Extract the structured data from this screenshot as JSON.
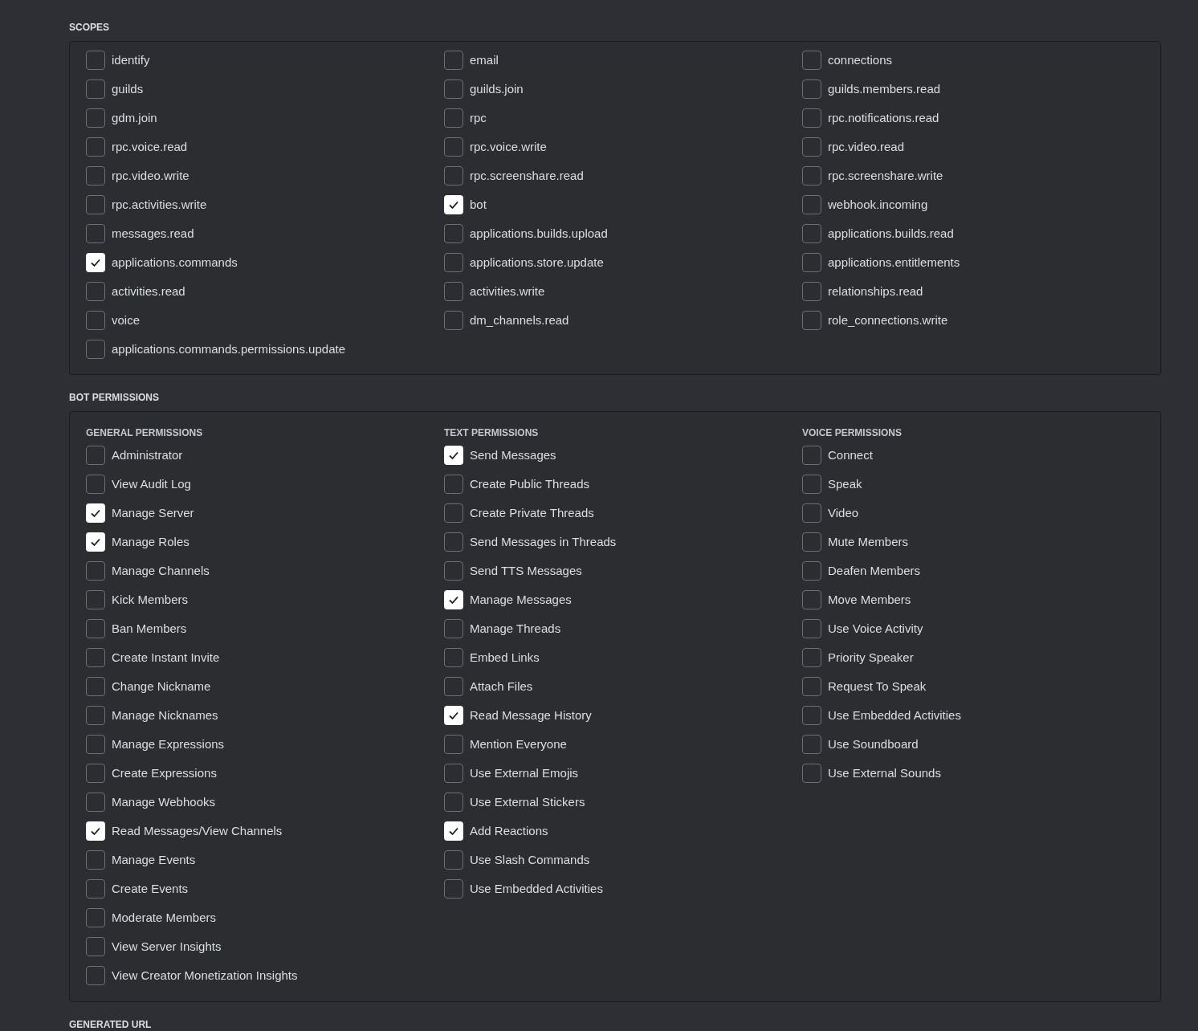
{
  "scopes": {
    "title": "SCOPES",
    "items": [
      {
        "label": "identify",
        "checked": false
      },
      {
        "label": "email",
        "checked": false
      },
      {
        "label": "connections",
        "checked": false
      },
      {
        "label": "guilds",
        "checked": false
      },
      {
        "label": "guilds.join",
        "checked": false
      },
      {
        "label": "guilds.members.read",
        "checked": false
      },
      {
        "label": "gdm.join",
        "checked": false
      },
      {
        "label": "rpc",
        "checked": false
      },
      {
        "label": "rpc.notifications.read",
        "checked": false
      },
      {
        "label": "rpc.voice.read",
        "checked": false
      },
      {
        "label": "rpc.voice.write",
        "checked": false
      },
      {
        "label": "rpc.video.read",
        "checked": false
      },
      {
        "label": "rpc.video.write",
        "checked": false
      },
      {
        "label": "rpc.screenshare.read",
        "checked": false
      },
      {
        "label": "rpc.screenshare.write",
        "checked": false
      },
      {
        "label": "rpc.activities.write",
        "checked": false
      },
      {
        "label": "bot",
        "checked": true
      },
      {
        "label": "webhook.incoming",
        "checked": false
      },
      {
        "label": "messages.read",
        "checked": false
      },
      {
        "label": "applications.builds.upload",
        "checked": false
      },
      {
        "label": "applications.builds.read",
        "checked": false
      },
      {
        "label": "applications.commands",
        "checked": true
      },
      {
        "label": "applications.store.update",
        "checked": false
      },
      {
        "label": "applications.entitlements",
        "checked": false
      },
      {
        "label": "activities.read",
        "checked": false
      },
      {
        "label": "activities.write",
        "checked": false
      },
      {
        "label": "relationships.read",
        "checked": false
      },
      {
        "label": "voice",
        "checked": false
      },
      {
        "label": "dm_channels.read",
        "checked": false
      },
      {
        "label": "role_connections.write",
        "checked": false
      },
      {
        "label": "applications.commands.permissions.update",
        "checked": false
      }
    ]
  },
  "bot_permissions": {
    "title": "BOT PERMISSIONS",
    "groups": [
      {
        "title": "GENERAL PERMISSIONS",
        "items": [
          {
            "label": "Administrator",
            "checked": false
          },
          {
            "label": "View Audit Log",
            "checked": false
          },
          {
            "label": "Manage Server",
            "checked": true
          },
          {
            "label": "Manage Roles",
            "checked": true
          },
          {
            "label": "Manage Channels",
            "checked": false
          },
          {
            "label": "Kick Members",
            "checked": false
          },
          {
            "label": "Ban Members",
            "checked": false
          },
          {
            "label": "Create Instant Invite",
            "checked": false
          },
          {
            "label": "Change Nickname",
            "checked": false
          },
          {
            "label": "Manage Nicknames",
            "checked": false
          },
          {
            "label": "Manage Expressions",
            "checked": false
          },
          {
            "label": "Create Expressions",
            "checked": false
          },
          {
            "label": "Manage Webhooks",
            "checked": false
          },
          {
            "label": "Read Messages/View Channels",
            "checked": true
          },
          {
            "label": "Manage Events",
            "checked": false
          },
          {
            "label": "Create Events",
            "checked": false
          },
          {
            "label": "Moderate Members",
            "checked": false
          },
          {
            "label": "View Server Insights",
            "checked": false
          },
          {
            "label": "View Creator Monetization Insights",
            "checked": false
          }
        ]
      },
      {
        "title": "TEXT PERMISSIONS",
        "items": [
          {
            "label": "Send Messages",
            "checked": true
          },
          {
            "label": "Create Public Threads",
            "checked": false
          },
          {
            "label": "Create Private Threads",
            "checked": false
          },
          {
            "label": "Send Messages in Threads",
            "checked": false
          },
          {
            "label": "Send TTS Messages",
            "checked": false
          },
          {
            "label": "Manage Messages",
            "checked": true
          },
          {
            "label": "Manage Threads",
            "checked": false
          },
          {
            "label": "Embed Links",
            "checked": false
          },
          {
            "label": "Attach Files",
            "checked": false
          },
          {
            "label": "Read Message History",
            "checked": true
          },
          {
            "label": "Mention Everyone",
            "checked": false
          },
          {
            "label": "Use External Emojis",
            "checked": false
          },
          {
            "label": "Use External Stickers",
            "checked": false
          },
          {
            "label": "Add Reactions",
            "checked": true
          },
          {
            "label": "Use Slash Commands",
            "checked": false
          },
          {
            "label": "Use Embedded Activities",
            "checked": false
          }
        ]
      },
      {
        "title": "VOICE PERMISSIONS",
        "items": [
          {
            "label": "Connect",
            "checked": false
          },
          {
            "label": "Speak",
            "checked": false
          },
          {
            "label": "Video",
            "checked": false
          },
          {
            "label": "Mute Members",
            "checked": false
          },
          {
            "label": "Deafen Members",
            "checked": false
          },
          {
            "label": "Move Members",
            "checked": false
          },
          {
            "label": "Use Voice Activity",
            "checked": false
          },
          {
            "label": "Priority Speaker",
            "checked": false
          },
          {
            "label": "Request To Speak",
            "checked": false
          },
          {
            "label": "Use Embedded Activities",
            "checked": false
          },
          {
            "label": "Use Soundboard",
            "checked": false
          },
          {
            "label": "Use External Sounds",
            "checked": false
          }
        ]
      }
    ]
  },
  "generated_url": {
    "title": "GENERATED URL"
  }
}
